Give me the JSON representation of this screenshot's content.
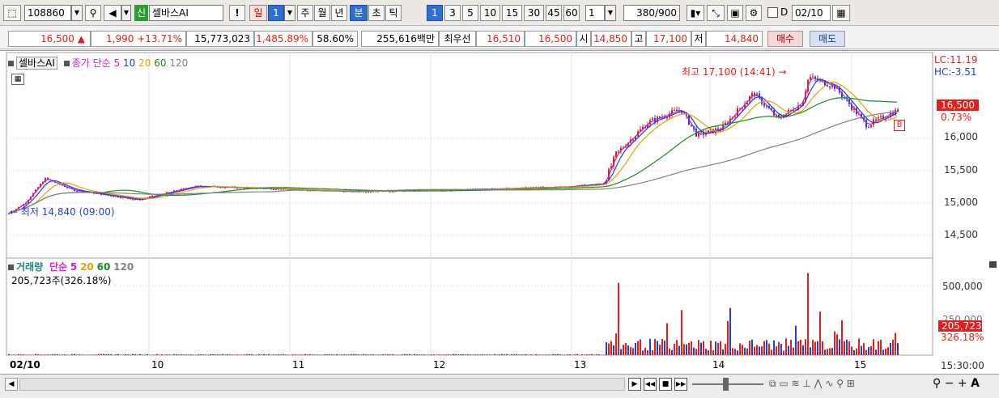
{
  "toolbar": {
    "code": "108860",
    "stock_tag": "신",
    "stock_name": "셀바스AI",
    "exclaim": "!",
    "periods": [
      "일",
      "1",
      "주",
      "월",
      "년",
      "분",
      "초",
      "틱"
    ],
    "minute_presets": [
      "1",
      "3",
      "5",
      "10",
      "15",
      "30",
      "45",
      "60"
    ],
    "interval_value": "1",
    "count_display": "380",
    "count_total": "/900",
    "d_label": "D",
    "date_value": "02/10"
  },
  "quote": {
    "price": "16,500",
    "change": "1,990",
    "change_pct": "+13.71%",
    "volume": "15,773,023",
    "vol_ratio": "1,485.89%",
    "pct2": "58.60%",
    "amount": "255,616백만",
    "best_label": "최우선",
    "best_ask": "16,510",
    "best_bid": "16,500",
    "open_label": "시",
    "open": "14,850",
    "high_label": "고",
    "high": "17,100",
    "low_label": "저",
    "low": "14,840",
    "buy_label": "매수",
    "sell_label": "매도"
  },
  "price_panel": {
    "legend_name": "셀바스AI",
    "legend_ma_label": "종가 단순",
    "ma": [
      "5",
      "10",
      "20",
      "60",
      "120"
    ],
    "lc": "LC:11.19",
    "hc": "HC:-3.51",
    "high_annot": "최고 17,100 (14:41)",
    "low_annot": "최저 14,840 (09:00)",
    "current_price": "16,500",
    "current_pct": "0.73%",
    "b_marker": "B",
    "y_ticks": [
      "16,000",
      "15,500",
      "15,000",
      "14,500"
    ]
  },
  "volume_panel": {
    "legend_name": "거래량",
    "legend_ma_label": "단순",
    "ma": [
      "5",
      "20",
      "60",
      "120"
    ],
    "current_volume": "205,723주(326.18%)",
    "y_ticks": [
      "500,000",
      "250,000"
    ],
    "current_value": "205,723",
    "current_pct": "326.18%",
    "time_label": "15:30:00"
  },
  "x_labels": [
    "02/10",
    "10",
    "11",
    "12",
    "13",
    "14",
    "15"
  ],
  "colors": {
    "up": "#e41d1d",
    "down": "#1f3fd6",
    "ma5": "#d020c0",
    "ma10": "#1f3fd6",
    "ma20": "#e8a000",
    "ma60": "#1a8a1a",
    "ma120": "#808080"
  }
}
